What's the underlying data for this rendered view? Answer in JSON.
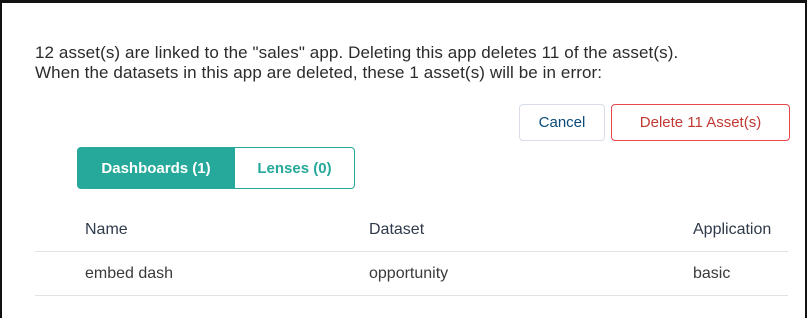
{
  "dialog": {
    "message_line1": "12 asset(s) are linked to the \"sales\" app. Deleting this app deletes 11 of the asset(s).",
    "message_line2": "When the datasets in this app are deleted, these 1 asset(s) will be in error:",
    "cancel_label": "Cancel",
    "delete_label": "Delete 11 Asset(s)"
  },
  "tabs": [
    {
      "label": "Dashboards (1)",
      "active": true
    },
    {
      "label": "Lenses (0)",
      "active": false
    }
  ],
  "table": {
    "columns": [
      "Name",
      "Dataset",
      "Application"
    ],
    "rows": [
      {
        "name": "embed dash",
        "dataset": "opportunity",
        "application": "basic"
      }
    ]
  },
  "colors": {
    "accent_teal": "#26a99a",
    "danger_red": "#c23934",
    "link_blue": "#1976d2",
    "app_purple": "#5b2c91"
  }
}
